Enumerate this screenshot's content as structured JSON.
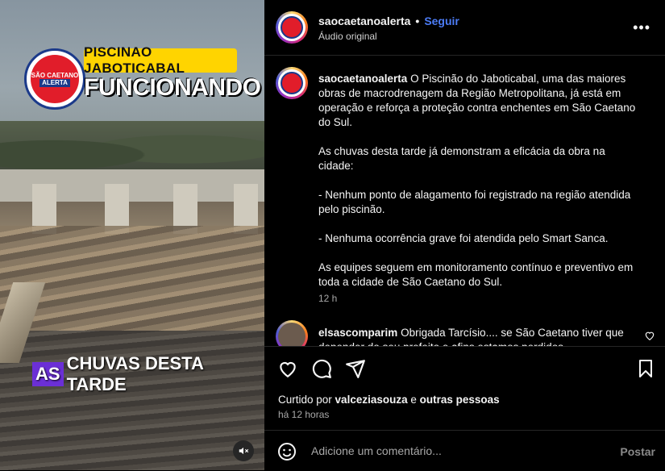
{
  "media": {
    "logo_line1": "SÃO CAETANO",
    "logo_line2": "ALERTA",
    "title_top": "PISCINAO JABOTICABAL",
    "title_main": "FUNCIONANDO",
    "caption_highlight": "AS",
    "caption_rest": "CHUVAS DESTA TARDE",
    "mute_icon": "speaker-muted-icon"
  },
  "header": {
    "username": "saocaetanoalerta",
    "separator": "•",
    "follow_label": "Seguir",
    "audio_label": "Áudio original",
    "more_label": "•••"
  },
  "post": {
    "author": "saocaetanoalerta",
    "caption": " O Piscinão do Jaboticabal, uma das maiores obras de macrodrenagem da Região Metropolitana, já está em operação e reforça a proteção contra enchentes em São Caetano do Sul.\n\nAs chuvas desta tarde já demonstram a eficácia da obra na cidade:\n\n- Nenhum ponto de alagamento foi registrado na região atendida pelo piscinão.\n\n- Nenhuma ocorrência grave foi atendida pelo Smart Sanca.\n\nAs equipes seguem em monitoramento contínuo e preventivo em toda a cidade de São Caetano do Sul.",
    "time": "12 h"
  },
  "comment": {
    "author": "elsascomparim",
    "text": " Obrigada Tarcísio.... se São Caetano tiver que depender do seu prefeito e afins estamos perdidos..."
  },
  "likes": {
    "prefix": "Curtido por ",
    "user": "valceziasouza",
    "middle": " e ",
    "others": "outras pessoas",
    "ago": "há 12 horas"
  },
  "comment_box": {
    "placeholder": "Adicione um comentário...",
    "post_label": "Postar"
  },
  "colors": {
    "accent": "#4c7cf6",
    "banner_yellow": "#ffd400",
    "caption_purple": "#6b2fd6"
  }
}
